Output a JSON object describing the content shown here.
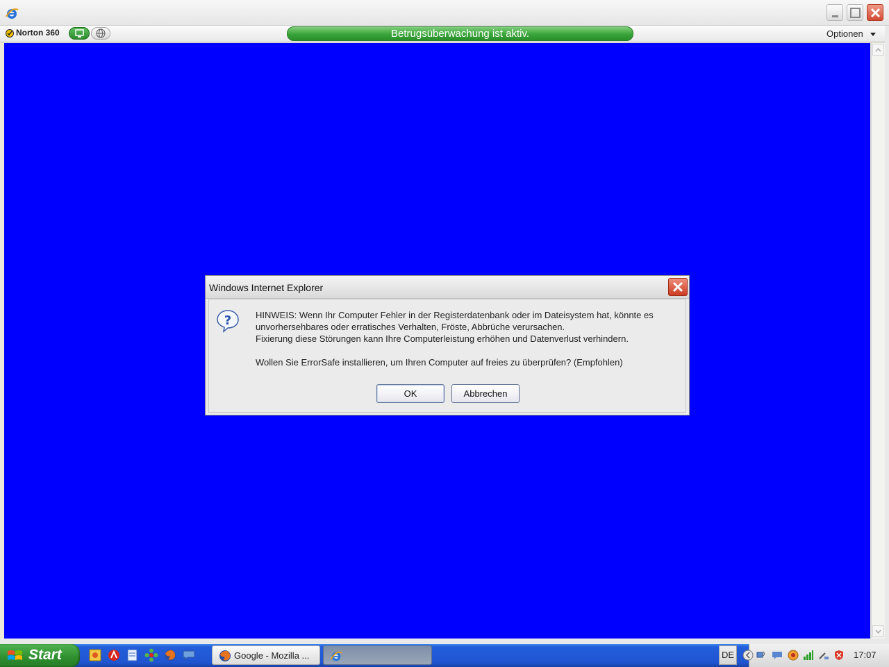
{
  "window": {
    "norton_label": "Norton 360",
    "fraud_status": "Betrugsüberwachung ist aktiv.",
    "options_label": "Optionen"
  },
  "content": {
    "background_color": "#0000fe"
  },
  "dialog": {
    "title": "Windows Internet Explorer",
    "line1": "HINWEIS:  Wenn Ihr Computer Fehler in der Registerdatenbank oder im Dateisystem hat, könnte es",
    "line2": "unvorhersehbares oder erratisches Verhalten, Fröste, Abbrüche verursachen.",
    "line3": "Fixierung diese Störungen kann Ihre Computerleistung erhöhen und Datenverlust verhindern.",
    "line4": "Wollen Sie ErrorSafe installieren, um Ihren Computer auf freies zu überprüfen? (Empfohlen)",
    "ok_label": "OK",
    "cancel_label": "Abbrechen",
    "icon": "question-icon"
  },
  "taskbar": {
    "start_label": "Start",
    "quicklaunch": [
      "photo-icon",
      "acrobat-icon",
      "notepad-icon",
      "icq-icon",
      "firefox-icon",
      "chat-icon"
    ],
    "tasks": [
      {
        "label": "Google - Mozilla ...",
        "icon": "firefox-icon"
      },
      {
        "label": "",
        "icon": "ie-icon"
      }
    ],
    "language": "DE",
    "clock": "17:07"
  }
}
